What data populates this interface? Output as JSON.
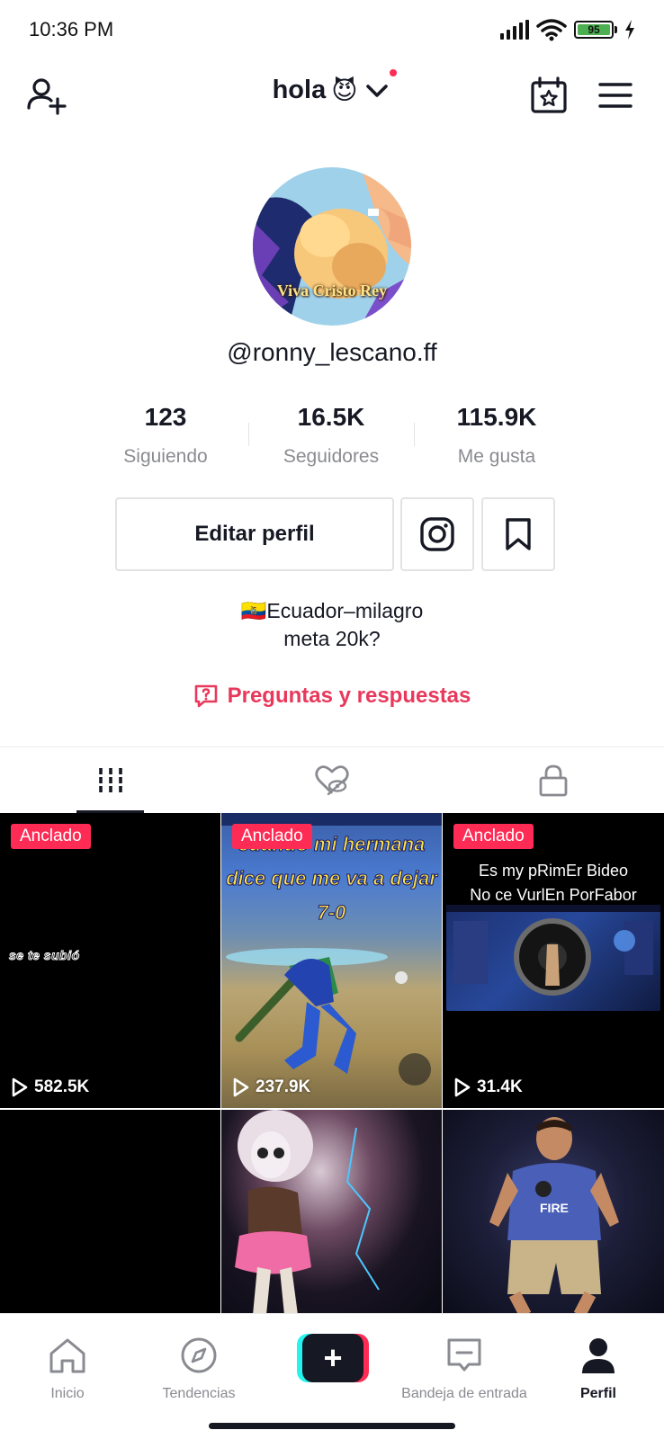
{
  "status_bar": {
    "time": "10:36 PM",
    "battery": "95"
  },
  "header": {
    "title": "hola",
    "title_emoji": "😈"
  },
  "profile": {
    "avatar_caption": "Viva Cristo Rey",
    "username": "@ronny_lescano.ff",
    "stats": [
      {
        "value": "123",
        "label": "Siguiendo"
      },
      {
        "value": "16.5K",
        "label": "Seguidores"
      },
      {
        "value": "115.9K",
        "label": "Me gusta"
      }
    ],
    "edit_button_label": "Editar perfil",
    "bio_line_1": "🇪🇨Ecuador–milagro",
    "bio_line_2": "meta 20k?",
    "qa_label": "Preguntas y respuestas"
  },
  "grid": {
    "videos": [
      {
        "pinned_label": "Anclado",
        "views": "582.5K",
        "overlay_text": "se te subió"
      },
      {
        "pinned_label": "Anclado",
        "views": "237.9K",
        "overlay_lines": [
          "cuando mi hermana",
          "dice que me va a dejar",
          "7-0"
        ]
      },
      {
        "pinned_label": "Anclado",
        "views": "31.4K",
        "overlay_lines": [
          "Es my pRimEr Bideo",
          "No ce VurlEn PorFabor"
        ]
      },
      {
        "views": ""
      },
      {
        "views": ""
      },
      {
        "views": ""
      }
    ]
  },
  "bottom_nav": {
    "items": [
      {
        "label": "Inicio",
        "icon": "home-icon"
      },
      {
        "label": "Tendencias",
        "icon": "compass-icon"
      },
      {
        "label": "Bandeja de entrada",
        "icon": "inbox-icon"
      },
      {
        "label": "Perfil",
        "icon": "profile-icon"
      }
    ]
  },
  "colors": {
    "accent": "#fe2c55",
    "qa": "#e8385b",
    "text": "#161823",
    "muted": "#8a8b91"
  }
}
